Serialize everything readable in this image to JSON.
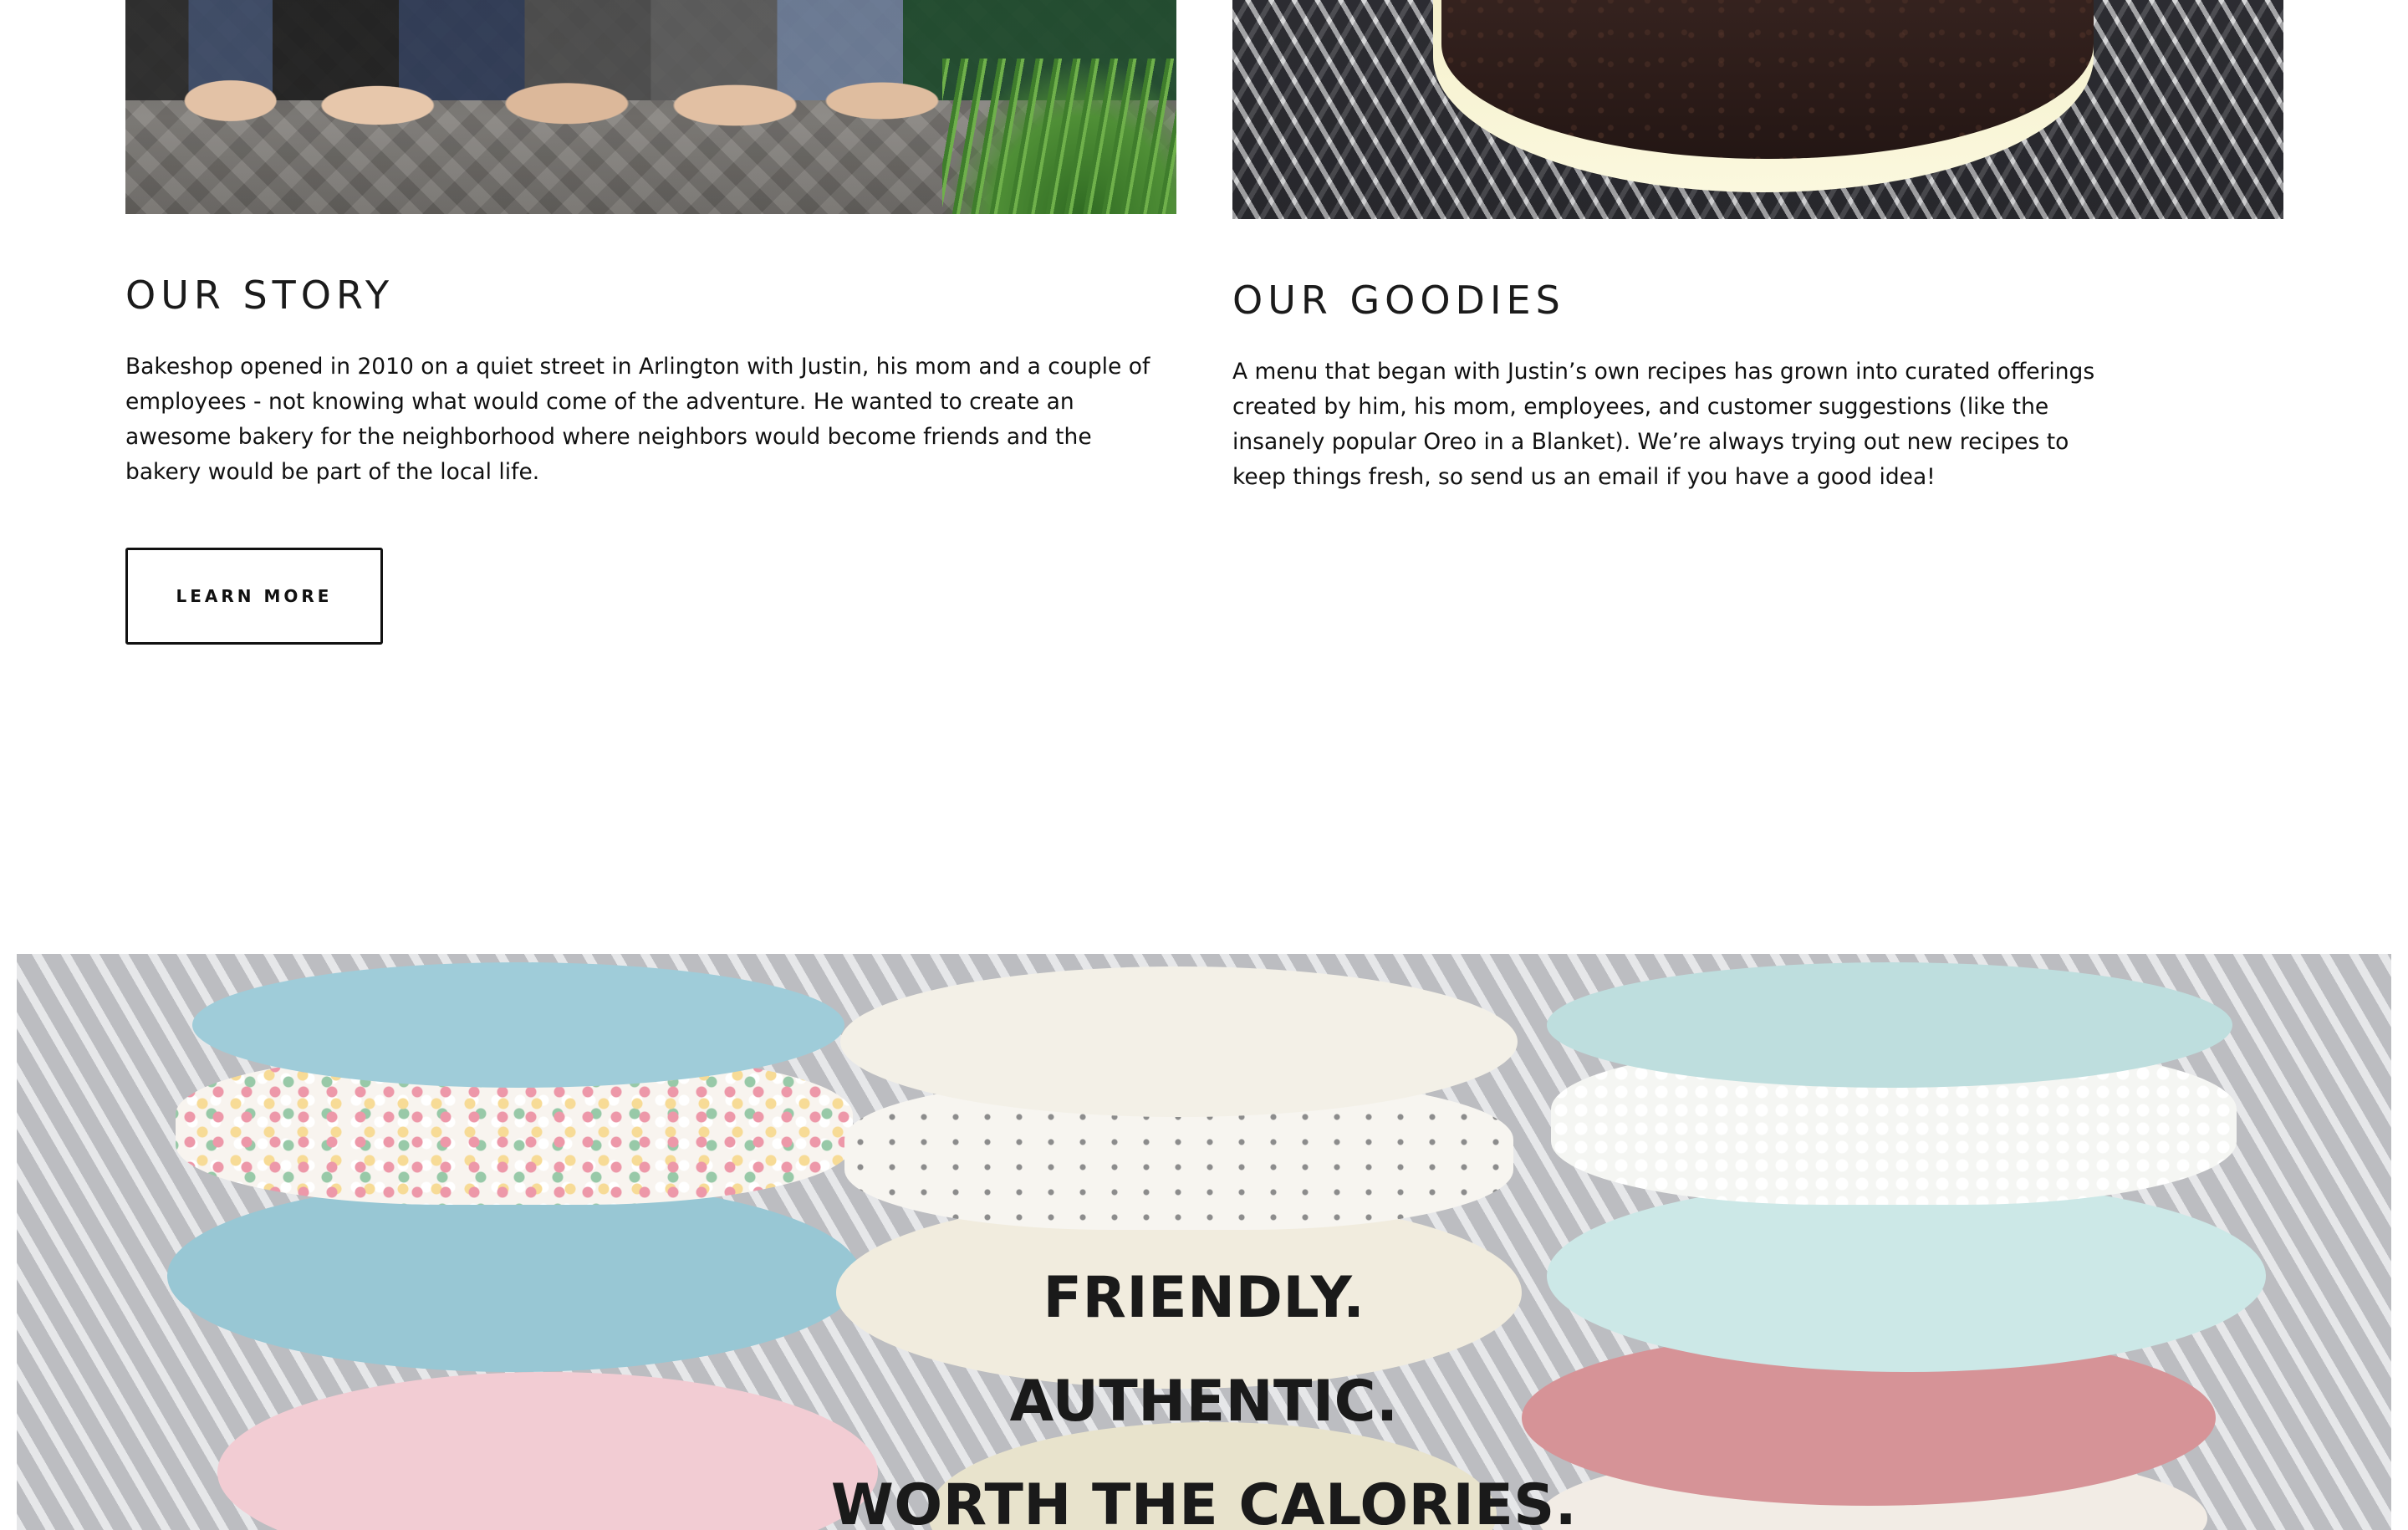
{
  "story": {
    "title": "OUR STORY",
    "body": "Bakeshop opened in 2010 on a quiet street in Arlington with Justin, his mom and a couple of employees - not knowing what would come of the adventure.  He wanted to create an awesome bakery for the neighborhood where neighbors would become friends and the bakery would be part of the local life.",
    "button_label": "LEARN MORE"
  },
  "goodies": {
    "title": "OUR GOODIES",
    "body": "A menu that began with Justin’s own recipes has grown into curated offerings created by him, his mom, employees, and customer suggestions (like the insanely popular Oreo in a Blanket). We’re always trying out new recipes to keep things fresh, so send us an email if you have a good idea!"
  },
  "banner": {
    "lines": [
      "FRIENDLY.",
      "AUTHENTIC.",
      "WORTH THE CALORIES."
    ]
  }
}
